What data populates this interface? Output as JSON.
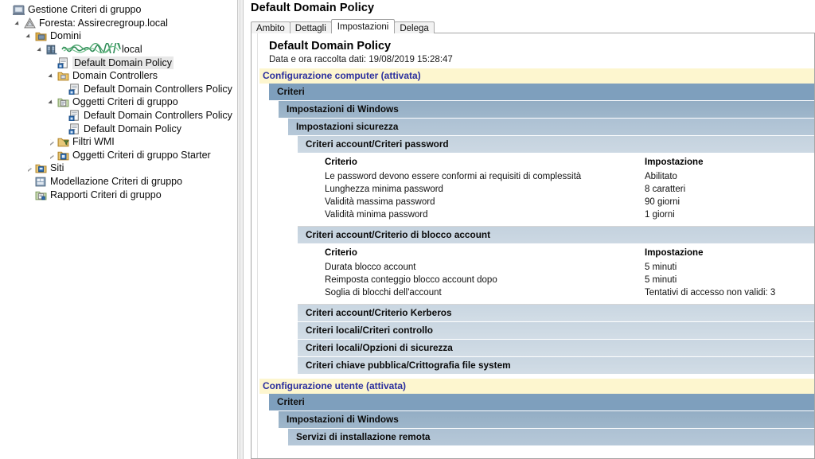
{
  "tree": {
    "items": [
      {
        "label": "Gestione Criteri di gruppo",
        "depth": 0,
        "twisty": "none",
        "icon": "console-root-icon",
        "selected": false
      },
      {
        "label": "Foresta: Assirecregroup.local",
        "depth": 1,
        "twisty": "open",
        "icon": "forest-icon",
        "selected": false
      },
      {
        "label": "Domini",
        "depth": 2,
        "twisty": "open",
        "icon": "domains-folder-icon",
        "selected": false
      },
      {
        "label": "local",
        "depth": 3,
        "twisty": "open",
        "icon": "domain-icon",
        "selected": false,
        "redacted": true
      },
      {
        "label": "Default Domain Policy",
        "depth": 4,
        "twisty": "none",
        "icon": "gpo-icon",
        "selected": true
      },
      {
        "label": "Domain Controllers",
        "depth": 4,
        "twisty": "open",
        "icon": "ou-icon",
        "selected": false
      },
      {
        "label": "Default Domain Controllers Policy",
        "depth": 5,
        "twisty": "none",
        "icon": "gpo-link-icon",
        "selected": false
      },
      {
        "label": "Oggetti Criteri di gruppo",
        "depth": 4,
        "twisty": "open",
        "icon": "gpo-folder-icon",
        "selected": false
      },
      {
        "label": "Default Domain Controllers Policy",
        "depth": 5,
        "twisty": "none",
        "icon": "gpo-icon",
        "selected": false
      },
      {
        "label": "Default Domain Policy",
        "depth": 5,
        "twisty": "none",
        "icon": "gpo-icon",
        "selected": false
      },
      {
        "label": "Filtri WMI",
        "depth": 4,
        "twisty": "closed",
        "icon": "wmi-filter-icon",
        "selected": false
      },
      {
        "label": "Oggetti Criteri di gruppo Starter",
        "depth": 4,
        "twisty": "closed",
        "icon": "starter-gpo-icon",
        "selected": false
      },
      {
        "label": "Siti",
        "depth": 2,
        "twisty": "closed",
        "icon": "sites-icon",
        "selected": false
      },
      {
        "label": "Modellazione Criteri di gruppo",
        "depth": 2,
        "twisty": "none",
        "icon": "modeling-icon",
        "selected": false
      },
      {
        "label": "Rapporti Criteri di gruppo",
        "depth": 2,
        "twisty": "none",
        "icon": "results-icon",
        "selected": false
      }
    ]
  },
  "right": {
    "title": "Default Domain Policy",
    "tabs": [
      {
        "label": "Ambito",
        "active": false
      },
      {
        "label": "Dettagli",
        "active": false
      },
      {
        "label": "Impostazioni",
        "active": true
      },
      {
        "label": "Delega",
        "active": false
      }
    ]
  },
  "report": {
    "heading": "Default Domain Policy",
    "collected": "Data e ora raccolta dati: 19/08/2019 15:28:47",
    "computer_config": "Configurazione computer (attivata)",
    "user_config": "Configurazione utente (attivata)",
    "criteri": "Criteri",
    "windows_settings": "Impostazioni di Windows",
    "security_settings": "Impostazioni sicurezza",
    "col_criterio": "Criterio",
    "col_impostazione": "Impostazione",
    "password_policy": {
      "title": "Criteri account/Criteri password",
      "rows": [
        {
          "criterio": "Le password devono essere conformi ai requisiti di complessità",
          "impostazione": "Abilitato"
        },
        {
          "criterio": "Lunghezza minima password",
          "impostazione": "8 caratteri"
        },
        {
          "criterio": "Validità massima password",
          "impostazione": "90 giorni"
        },
        {
          "criterio": "Validità minima password",
          "impostazione": "1 giorni"
        }
      ]
    },
    "lockout_policy": {
      "title": "Criteri account/Criterio di blocco account",
      "rows": [
        {
          "criterio": "Durata blocco account",
          "impostazione": "5 minuti"
        },
        {
          "criterio": "Reimposta conteggio blocco account dopo",
          "impostazione": "5 minuti"
        },
        {
          "criterio": "Soglia di blocchi dell'account",
          "impostazione": "Tentativi di accesso non validi: 3"
        }
      ]
    },
    "collapsed_sections": [
      "Criteri account/Criterio Kerberos",
      "Criteri locali/Criteri controllo",
      "Criteri locali/Opzioni di sicurezza",
      "Criteri chiave pubblica/Crittografia file system"
    ],
    "user_remote_install": "Servizi di installazione remota"
  },
  "colors": {
    "band_l1": "#7e9fbd",
    "band_l2": "#9bb3c8",
    "band_l3": "#b2c5d5",
    "band_l4": "#c8d5e0",
    "config_band_bg": "#fdf6cf",
    "config_band_text": "#2b2f9e",
    "selection": "#e8e8e8"
  }
}
